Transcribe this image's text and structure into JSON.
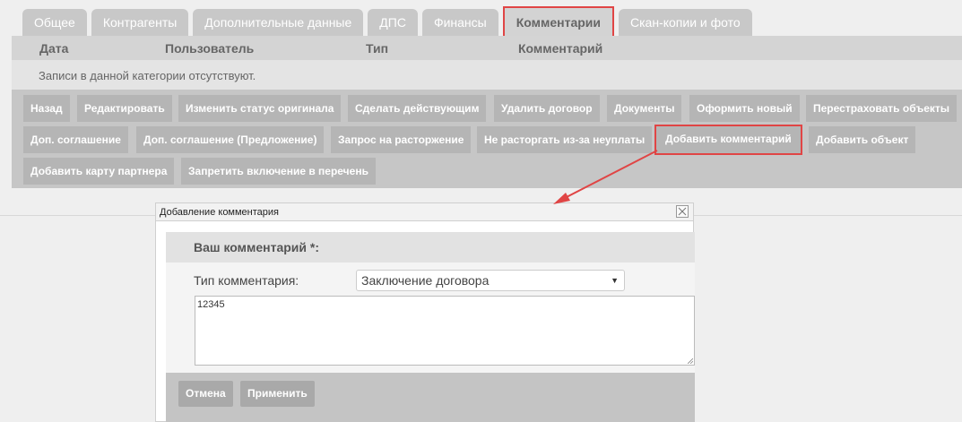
{
  "tabs": [
    {
      "label": "Общее"
    },
    {
      "label": "Контрагенты"
    },
    {
      "label": "Дополнительные данные"
    },
    {
      "label": "ДПС"
    },
    {
      "label": "Финансы"
    },
    {
      "label": "Комментарии",
      "active": true
    },
    {
      "label": "Скан-копии и фото"
    }
  ],
  "grid": {
    "columns": [
      "Дата",
      "Пользователь",
      "Тип",
      "Комментарий"
    ],
    "empty_text": "Записи в данной категории отсутствуют."
  },
  "actions": {
    "row1": [
      "Назад",
      "Редактировать",
      "Изменить статус оригинала",
      "Сделать действующим",
      "Удалить договор",
      "Документы",
      "Оформить новый",
      "Перестраховать объекты"
    ],
    "row2": [
      "Доп. соглашение",
      "Доп. соглашение (Предложение)",
      "Запрос на расторжение",
      "Не расторгать из-за неуплаты",
      "Добавить комментарий",
      "Добавить объект"
    ],
    "row3": [
      "Добавить карту партнера",
      "Запретить включение в перечень"
    ]
  },
  "dialog": {
    "title": "Добавление комментария",
    "section_title": "Ваш комментарий *:",
    "type_label": "Тип комментария:",
    "type_value": "Заключение договора",
    "comment_text": "12345",
    "cancel_label": "Отмена",
    "apply_label": "Применить"
  },
  "colors": {
    "highlight": "#e04545",
    "button_bg": "#b5b5b5"
  }
}
